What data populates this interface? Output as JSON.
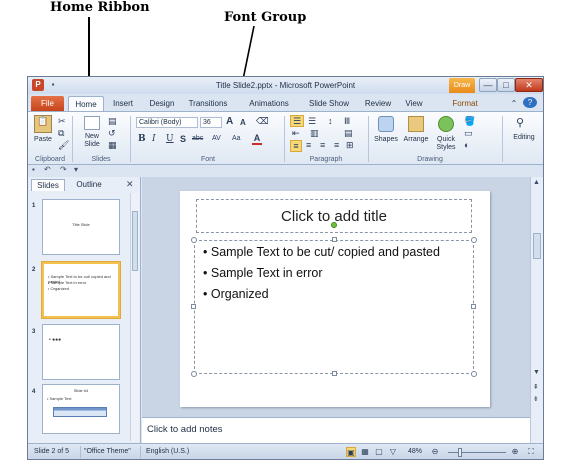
{
  "annotations": {
    "home_ribbon": "Home Ribbon",
    "font_group": "Font Group"
  },
  "window": {
    "title": "Title Slide2.pptx - Microsoft PowerPoint",
    "drawing_context_tab": "Draw",
    "app_icon": "P",
    "controls": {
      "minimize": "—",
      "maximize": "□",
      "close": "✕"
    }
  },
  "tabs": [
    "File",
    "Home",
    "Insert",
    "Design",
    "Transitions",
    "Animations",
    "Slide Show",
    "Review",
    "View",
    "Format"
  ],
  "ribbon": {
    "clipboard": {
      "paste": "Paste",
      "label": "Clipboard"
    },
    "slides": {
      "new_slide_1": "New",
      "new_slide_2": "Slide",
      "label": "Slides"
    },
    "font": {
      "font_name": "Calibri (Body)",
      "font_size": "36",
      "grow": "A",
      "shrink": "A",
      "bold": "B",
      "italic": "I",
      "underline": "U",
      "shadow": "S",
      "strikethrough": "abc",
      "spacing": "AV",
      "change_case": "Aa",
      "font_color": "A",
      "label": "Font"
    },
    "paragraph": {
      "label": "Paragraph"
    },
    "drawing": {
      "shapes": "Shapes",
      "arrange": "Arrange",
      "quick_styles_1": "Quick",
      "quick_styles_2": "Styles",
      "label": "Drawing"
    },
    "editing": {
      "label": "Editing"
    }
  },
  "left_pane": {
    "tabs": [
      "Slides",
      "Outline"
    ],
    "close": "✕",
    "thumbnails": [
      {
        "num": "1",
        "lines": [
          "Title Slide"
        ]
      },
      {
        "num": "2",
        "lines": [
          "• Sample Text to be cut/ copied and pasted",
          "• Sample Text in error",
          "• Organized"
        ]
      },
      {
        "num": "3",
        "lines": [
          "• ●●●"
        ]
      },
      {
        "num": "4",
        "lines": [
          "Slide #4",
          "• Sample Text"
        ]
      }
    ]
  },
  "slide": {
    "title": "Click to add title",
    "bullets": [
      "Sample Text to be cut/ copied and pasted",
      "Sample Text in error",
      "Organized"
    ]
  },
  "notes": {
    "placeholder": "Click to add notes"
  },
  "status_bar": {
    "slide_info": "Slide 2 of 5",
    "theme": "\"Office Theme\"",
    "language": "English (U.S.)",
    "zoom": "48%",
    "zoom_level": 0.48
  },
  "colors": {
    "file_tab": "#c5451c",
    "window_chrome": "#dbe5f1",
    "selected_thumb": "#f2c14e",
    "rotate_handle": "#6fc23a"
  }
}
